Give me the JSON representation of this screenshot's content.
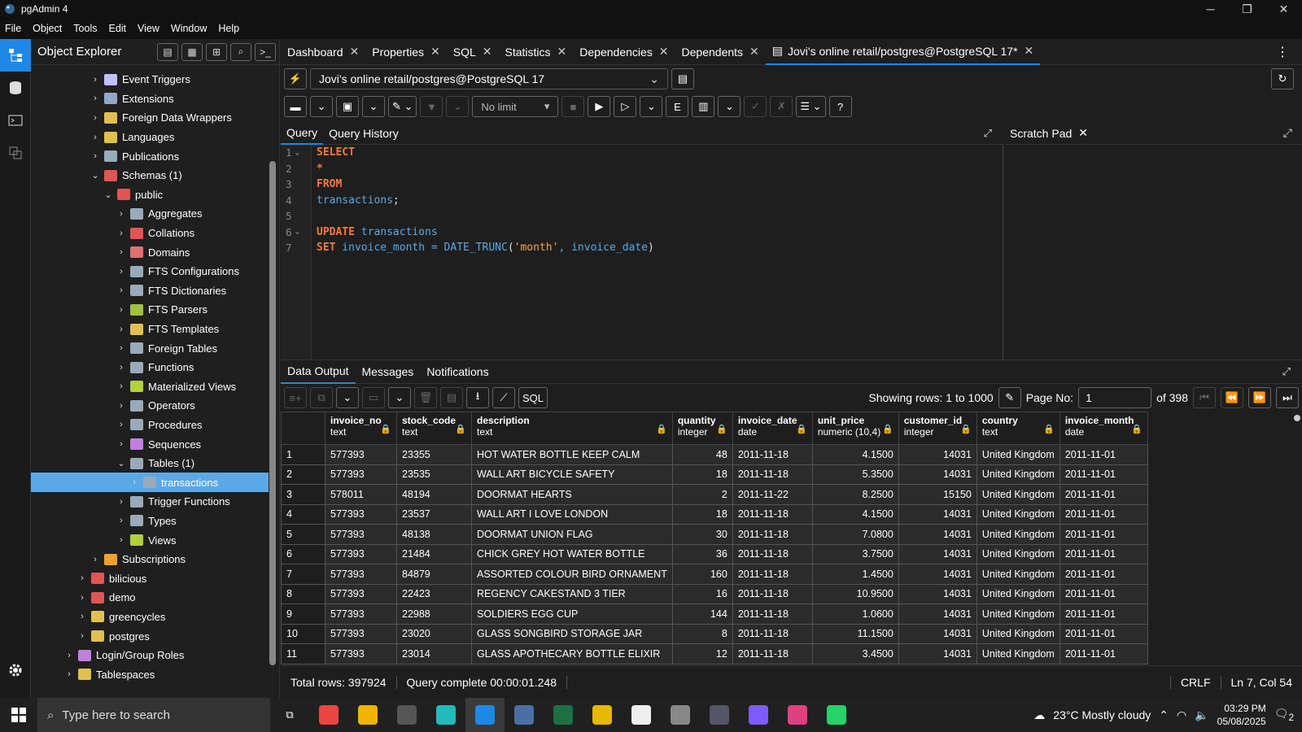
{
  "window": {
    "title": "pgAdmin 4",
    "min": "─",
    "max": "❐",
    "close": "✕"
  },
  "menu": [
    "File",
    "Object",
    "Tools",
    "Edit",
    "View",
    "Window",
    "Help"
  ],
  "explorer": {
    "title": "Object Explorer",
    "tree": [
      {
        "label": "Event Triggers",
        "indent": 2,
        "arrow": "›",
        "color": "#c0c0ff"
      },
      {
        "label": "Extensions",
        "indent": 2,
        "arrow": "›",
        "color": "#8fa8c8"
      },
      {
        "label": "Foreign Data Wrappers",
        "indent": 2,
        "arrow": "›",
        "color": "#e0c050"
      },
      {
        "label": "Languages",
        "indent": 2,
        "arrow": "›",
        "color": "#e0c050"
      },
      {
        "label": "Publications",
        "indent": 2,
        "arrow": "›",
        "color": "#9ab"
      },
      {
        "label": "Schemas (1)",
        "indent": 2,
        "arrow": "⌄",
        "color": "#e05555"
      },
      {
        "label": "public",
        "indent": 3,
        "arrow": "⌄",
        "color": "#e05555"
      },
      {
        "label": "Aggregates",
        "indent": 4,
        "arrow": "›",
        "color": "#9ab"
      },
      {
        "label": "Collations",
        "indent": 4,
        "arrow": "›",
        "color": "#e05555"
      },
      {
        "label": "Domains",
        "indent": 4,
        "arrow": "›",
        "color": "#e07070"
      },
      {
        "label": "FTS Configurations",
        "indent": 4,
        "arrow": "›",
        "color": "#9ab"
      },
      {
        "label": "FTS Dictionaries",
        "indent": 4,
        "arrow": "›",
        "color": "#9ab"
      },
      {
        "label": "FTS Parsers",
        "indent": 4,
        "arrow": "›",
        "color": "#a0c040"
      },
      {
        "label": "FTS Templates",
        "indent": 4,
        "arrow": "›",
        "color": "#e0c050"
      },
      {
        "label": "Foreign Tables",
        "indent": 4,
        "arrow": "›",
        "color": "#9ab"
      },
      {
        "label": "Functions",
        "indent": 4,
        "arrow": "›",
        "color": "#9ab"
      },
      {
        "label": "Materialized Views",
        "indent": 4,
        "arrow": "›",
        "color": "#b0d040"
      },
      {
        "label": "Operators",
        "indent": 4,
        "arrow": "›",
        "color": "#9ab"
      },
      {
        "label": "Procedures",
        "indent": 4,
        "arrow": "›",
        "color": "#9ab"
      },
      {
        "label": "Sequences",
        "indent": 4,
        "arrow": "›",
        "color": "#c080e0"
      },
      {
        "label": "Tables (1)",
        "indent": 4,
        "arrow": "⌄",
        "color": "#9ab"
      },
      {
        "label": "transactions",
        "indent": 5,
        "arrow": "›",
        "color": "#9ab",
        "selected": true
      },
      {
        "label": "Trigger Functions",
        "indent": 4,
        "arrow": "›",
        "color": "#9ab"
      },
      {
        "label": "Types",
        "indent": 4,
        "arrow": "›",
        "color": "#9ab"
      },
      {
        "label": "Views",
        "indent": 4,
        "arrow": "›",
        "color": "#b0d040"
      },
      {
        "label": "Subscriptions",
        "indent": 2,
        "arrow": "›",
        "color": "#f0a030"
      },
      {
        "label": "bilicious",
        "indent": 1,
        "arrow": "›",
        "color": "#e05555"
      },
      {
        "label": "demo",
        "indent": 1,
        "arrow": "›",
        "color": "#e05555"
      },
      {
        "label": "greencycles",
        "indent": 1,
        "arrow": "›",
        "color": "#e0c050"
      },
      {
        "label": "postgres",
        "indent": 1,
        "arrow": "›",
        "color": "#e0c050"
      },
      {
        "label": "Login/Group Roles",
        "indent": 0,
        "arrow": "›",
        "color": "#c080e0"
      },
      {
        "label": "Tablespaces",
        "indent": 0,
        "arrow": "›",
        "color": "#e0c050"
      }
    ]
  },
  "tabs": [
    {
      "label": "Dashboard"
    },
    {
      "label": "Properties"
    },
    {
      "label": "SQL"
    },
    {
      "label": "Statistics"
    },
    {
      "label": "Dependencies"
    },
    {
      "label": "Dependents"
    },
    {
      "label": "Jovi's online retail/postgres@PostgreSQL 17*",
      "active": true
    }
  ],
  "connection": "Jovi's online retail/postgres@PostgreSQL 17",
  "toolbar": {
    "limit": "No limit"
  },
  "editor": {
    "tabs": [
      "Query",
      "Query History"
    ],
    "scratch_title": "Scratch Pad",
    "lines": [
      [
        {
          "t": "SELECT",
          "c": "kw"
        }
      ],
      [
        {
          "t": "*",
          "c": "kw"
        }
      ],
      [
        {
          "t": "FROM",
          "c": "kw"
        }
      ],
      [
        {
          "t": "transactions",
          "c": "id"
        },
        {
          "t": ";",
          "c": "pl"
        }
      ],
      [],
      [
        {
          "t": "UPDATE",
          "c": "kw"
        },
        {
          "t": " transactions",
          "c": "id"
        }
      ],
      [
        {
          "t": "SET",
          "c": "kw"
        },
        {
          "t": " invoice_month = DATE_TRUNC",
          "c": "id"
        },
        {
          "t": "(",
          "c": "pl"
        },
        {
          "t": "'month'",
          "c": "str"
        },
        {
          "t": ", invoice_date",
          "c": "id"
        },
        {
          "t": ")",
          "c": "pl"
        }
      ]
    ]
  },
  "output": {
    "tabs": [
      "Data Output",
      "Messages",
      "Notifications"
    ],
    "showing": "Showing rows: 1 to 1000",
    "page_label": "Page No:",
    "page_value": "1",
    "page_of": "of 398",
    "sql_btn": "SQL",
    "columns": [
      {
        "name": "invoice_no",
        "type": "text"
      },
      {
        "name": "stock_code",
        "type": "text"
      },
      {
        "name": "description",
        "type": "text"
      },
      {
        "name": "quantity",
        "type": "integer"
      },
      {
        "name": "invoice_date",
        "type": "date"
      },
      {
        "name": "unit_price",
        "type": "numeric (10,4)"
      },
      {
        "name": "customer_id",
        "type": "integer"
      },
      {
        "name": "country",
        "type": "text"
      },
      {
        "name": "invoice_month",
        "type": "date"
      }
    ],
    "rows": [
      [
        "1",
        "577393",
        "23355",
        "HOT WATER BOTTLE KEEP CALM",
        "48",
        "2011-11-18",
        "4.1500",
        "14031",
        "United Kingdom",
        "2011-11-01"
      ],
      [
        "2",
        "577393",
        "23535",
        "WALL ART BICYCLE SAFETY",
        "18",
        "2011-11-18",
        "5.3500",
        "14031",
        "United Kingdom",
        "2011-11-01"
      ],
      [
        "3",
        "578011",
        "48194",
        "DOORMAT HEARTS",
        "2",
        "2011-11-22",
        "8.2500",
        "15150",
        "United Kingdom",
        "2011-11-01"
      ],
      [
        "4",
        "577393",
        "23537",
        "WALL ART I LOVE LONDON",
        "18",
        "2011-11-18",
        "4.1500",
        "14031",
        "United Kingdom",
        "2011-11-01"
      ],
      [
        "5",
        "577393",
        "48138",
        "DOORMAT UNION FLAG",
        "30",
        "2011-11-18",
        "7.0800",
        "14031",
        "United Kingdom",
        "2011-11-01"
      ],
      [
        "6",
        "577393",
        "21484",
        "CHICK GREY HOT WATER BOTTLE",
        "36",
        "2011-11-18",
        "3.7500",
        "14031",
        "United Kingdom",
        "2011-11-01"
      ],
      [
        "7",
        "577393",
        "84879",
        "ASSORTED COLOUR BIRD ORNAMENT",
        "160",
        "2011-11-18",
        "1.4500",
        "14031",
        "United Kingdom",
        "2011-11-01"
      ],
      [
        "8",
        "577393",
        "22423",
        "REGENCY CAKESTAND 3 TIER",
        "16",
        "2011-11-18",
        "10.9500",
        "14031",
        "United Kingdom",
        "2011-11-01"
      ],
      [
        "9",
        "577393",
        "22988",
        "SOLDIERS EGG CUP",
        "144",
        "2011-11-18",
        "1.0600",
        "14031",
        "United Kingdom",
        "2011-11-01"
      ],
      [
        "10",
        "577393",
        "23020",
        "GLASS  SONGBIRD STORAGE JAR",
        "8",
        "2011-11-18",
        "11.1500",
        "14031",
        "United Kingdom",
        "2011-11-01"
      ],
      [
        "11",
        "577393",
        "23014",
        "GLASS APOTHECARY BOTTLE ELIXIR",
        "12",
        "2011-11-18",
        "3.4500",
        "14031",
        "United Kingdom",
        "2011-11-01"
      ]
    ]
  },
  "status": {
    "total_rows": "Total rows: 397924",
    "query_complete": "Query complete 00:00:01.248",
    "eol": "CRLF",
    "cursor": "Ln 7, Col 54"
  },
  "taskbar": {
    "search_placeholder": "Type here to search",
    "weather": "23°C  Mostly cloudy",
    "time": "03:29 PM",
    "date": "05/08/2025",
    "notif_count": "2",
    "apps": [
      "#e44",
      "#f0b400",
      "#555",
      "#2bb",
      "#1e88e5",
      "#4a6fa5",
      "#1d7044",
      "#e6b800",
      "#eee",
      "#888",
      "#556",
      "#7c5cff",
      "#e04080",
      "#25d366"
    ]
  }
}
